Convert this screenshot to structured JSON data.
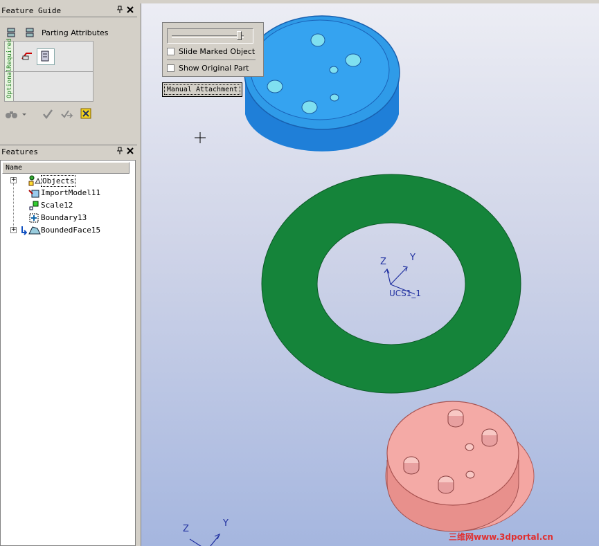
{
  "feature_guide": {
    "title": "Feature Guide",
    "pin_icon": "pin-icon",
    "close_icon": "close-icon",
    "parting_attributes_label": "Parting Attributes",
    "required_tab": "Required",
    "optional_tab": "Optional",
    "actions": [
      "binoculars-icon",
      "dropdown-arrow-icon",
      "checkmark-icon",
      "apply-next-icon",
      "cancel-x-icon"
    ]
  },
  "features_panel": {
    "title": "Features",
    "column_name": "Name",
    "items": [
      {
        "label": "Objects",
        "expandable": true,
        "selected": true,
        "icon": "objects-icon"
      },
      {
        "label": "ImportModel11",
        "expandable": false,
        "icon": "import-model-icon"
      },
      {
        "label": "Scale12",
        "expandable": false,
        "icon": "scale-icon"
      },
      {
        "label": "Boundary13",
        "expandable": false,
        "icon": "boundary-icon"
      },
      {
        "label": "BoundedFace15",
        "expandable": true,
        "icon": "bounded-face-icon"
      }
    ]
  },
  "slide_dialog": {
    "slide_marked_object": "Slide Marked Object",
    "show_original_part": "Show Original Part",
    "slider_value": 0.9
  },
  "manual_attachment": "Manual Attachment",
  "viewport": {
    "ucs_label": "UCS1_1",
    "axis_z": "Z",
    "axis_y": "Y",
    "colors": {
      "top_part": "#2f9be8",
      "ring": "#15843a",
      "bottom_part": "#f4a6a2",
      "axis": "#2030a0"
    }
  },
  "watermark": "三维网www.3dportal.cn"
}
